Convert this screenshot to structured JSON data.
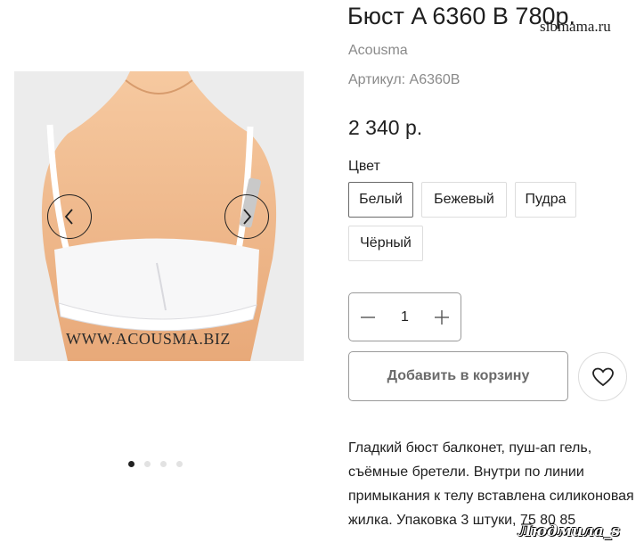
{
  "product": {
    "title": "Бюст A 6360 B 780р.",
    "brand": "Acousma",
    "sku": "Артикул: A6360B",
    "price": "2 340 р."
  },
  "watermark": "sibmama.ru",
  "gallery": {
    "caption": "WWW.ACOUSMA.BIZ",
    "dots_count": 4,
    "active_dot": 0
  },
  "options": {
    "color_label": "Цвет",
    "colors": [
      "Белый",
      "Бежевый",
      "Пудра",
      "Чёрный"
    ],
    "selected": "Белый"
  },
  "quantity": {
    "value": "1"
  },
  "cart": {
    "add_label": "Добавить в корзину"
  },
  "description": "Гладкий бюст балконет, пуш-ап гель, съёмные бретели. Внутри по линии примыкания к телу вставлена силиконовая жилка. Упаковка 3 штуки, 75 80 85",
  "signature": "Людмила_s",
  "icons": {
    "prev": "chevron-left-icon",
    "next": "chevron-right-icon",
    "minus": "minus-icon",
    "plus": "plus-icon",
    "favorite": "heart-icon"
  }
}
